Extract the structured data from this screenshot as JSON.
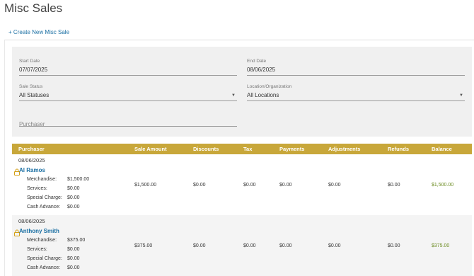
{
  "header": {
    "title": "Misc Sales",
    "create_link": "+ Create New Misc Sale"
  },
  "filters": {
    "start_date": {
      "label": "Start Date",
      "value": "07/07/2025"
    },
    "end_date": {
      "label": "End Date",
      "value": "08/06/2025"
    },
    "sale_status": {
      "label": "Sale Status",
      "value": "All Statuses"
    },
    "location": {
      "label": "Location/Organization",
      "value": "All Locations"
    },
    "purchaser": {
      "placeholder": "Purchaser"
    }
  },
  "table": {
    "columns": [
      "Purchaser",
      "Sale Amount",
      "Discounts",
      "Tax",
      "Payments",
      "Adjustments",
      "Refunds",
      "Balance"
    ],
    "breakdown_labels": [
      "Merchandise:",
      "Services:",
      "Special Charge:",
      "Cash Advance:"
    ],
    "rows": [
      {
        "date": "08/06/2025",
        "purchaser": "Al Ramos",
        "breakdown": [
          "$1,500.00",
          "$0.00",
          "$0.00",
          "$0.00"
        ],
        "sale_amount": "$1,500.00",
        "discounts": "$0.00",
        "tax": "$0.00",
        "payments": "$0.00",
        "adjustments": "$0.00",
        "refunds": "$0.00",
        "balance": "$1,500.00"
      },
      {
        "date": "08/06/2025",
        "purchaser": "Anthony Smith",
        "breakdown": [
          "$375.00",
          "$0.00",
          "$0.00",
          "$0.00"
        ],
        "sale_amount": "$375.00",
        "discounts": "$0.00",
        "tax": "$0.00",
        "payments": "$0.00",
        "adjustments": "$0.00",
        "refunds": "$0.00",
        "balance": "$375.00"
      }
    ]
  },
  "colors": {
    "header_gold": "#c8a73a",
    "link_blue": "#1a6fa3",
    "balance_green": "#6a8a1f",
    "lock_gold": "#d4a017"
  },
  "icons": {
    "row_lock": "lock-icon",
    "dropdown": "caret-down-icon"
  }
}
